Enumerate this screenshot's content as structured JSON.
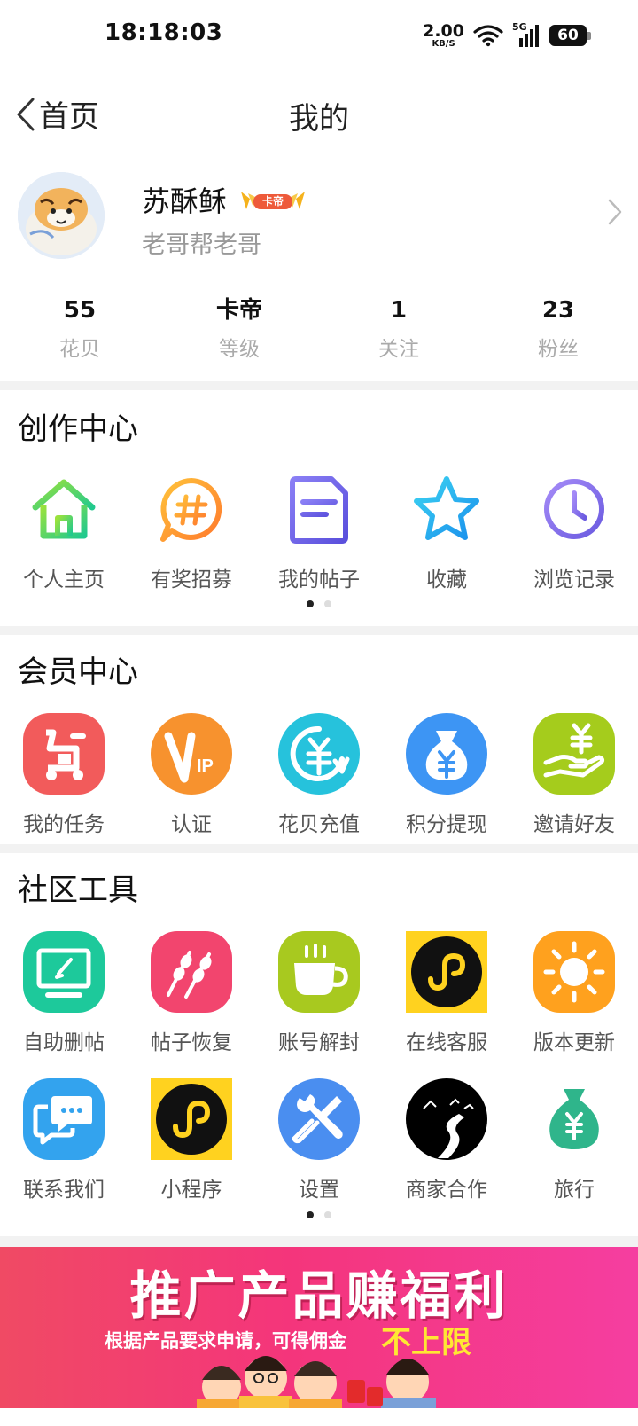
{
  "status_bar": {
    "time": "18:18:03",
    "net_speed": "2.00",
    "net_unit": "KB/S",
    "signal": "5G",
    "battery": "60"
  },
  "nav": {
    "back_label": "首页",
    "title": "我的"
  },
  "profile": {
    "name": "苏酥稣",
    "level_badge": "卡帝",
    "signature": "老哥帮老哥"
  },
  "stats": [
    {
      "value": "55",
      "label": "花贝"
    },
    {
      "value": "卡帝",
      "label": "等级"
    },
    {
      "value": "1",
      "label": "关注"
    },
    {
      "value": "23",
      "label": "粉丝"
    }
  ],
  "creation_center": {
    "title": "创作中心",
    "items": [
      {
        "label": "个人主页",
        "icon": "home-icon"
      },
      {
        "label": "有奖招募",
        "icon": "hashtag-icon"
      },
      {
        "label": "我的帖子",
        "icon": "document-icon"
      },
      {
        "label": "收藏",
        "icon": "star-icon"
      },
      {
        "label": "浏览记录",
        "icon": "clock-icon"
      }
    ]
  },
  "member_center": {
    "title": "会员中心",
    "items": [
      {
        "label": "我的任务",
        "icon": "task-icon",
        "color": "#f25b5b"
      },
      {
        "label": "认证",
        "icon": "vip-icon",
        "color": "#f7922e"
      },
      {
        "label": "花贝充值",
        "icon": "recharge-icon",
        "color": "#26c2dc"
      },
      {
        "label": "积分提现",
        "icon": "money-bag-icon",
        "color": "#3d95f4"
      },
      {
        "label": "邀请好友",
        "icon": "invite-icon",
        "color": "#a5cc1c"
      }
    ]
  },
  "community_tools": {
    "title": "社区工具",
    "row1": [
      {
        "label": "自助删帖",
        "icon": "monitor-icon",
        "color": "#1dc99b"
      },
      {
        "label": "帖子恢复",
        "icon": "skewer-icon",
        "color": "#f2456e"
      },
      {
        "label": "账号解封",
        "icon": "cup-icon",
        "color": "#a8c91f"
      },
      {
        "label": "在线客服",
        "icon": "mini-program-icon",
        "color": "#ffd21f"
      },
      {
        "label": "版本更新",
        "icon": "sun-icon",
        "color": "#ffa11e"
      }
    ],
    "row2": [
      {
        "label": "联系我们",
        "icon": "chat-icon",
        "color": "#33a3ee"
      },
      {
        "label": "小程序",
        "icon": "mini-program-icon",
        "color": "#ffd21f"
      },
      {
        "label": "设置",
        "icon": "wrench-icon",
        "color": "#4a8ef0"
      },
      {
        "label": "商家合作",
        "icon": "road-icon",
        "color": "#000000"
      },
      {
        "label": "旅行",
        "icon": "money-bag-icon",
        "color": "#2fb58b"
      }
    ]
  },
  "banner": {
    "title": "推广产品赚福利",
    "subtitle": "根据产品要求申请，可得佣金",
    "accent": "不上限"
  }
}
